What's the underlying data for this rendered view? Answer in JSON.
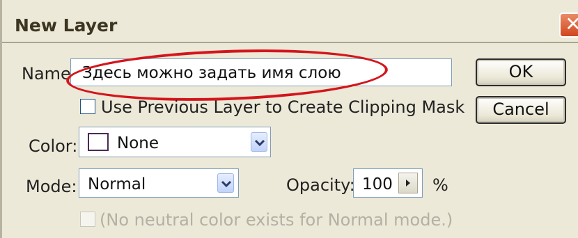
{
  "dialog": {
    "title": "New Layer",
    "close_symbol": "✕",
    "name_label": "Name:",
    "name_value": "Здесь можно задать имя слою",
    "clipping_mask_label": "Use Previous Layer to Create Clipping Mask",
    "clipping_mask_checked": false,
    "color_label": "Color:",
    "color_value": "None",
    "mode_label": "Mode:",
    "mode_value": "Normal",
    "opacity_label": "Opacity:",
    "opacity_value": "100",
    "opacity_unit": "%",
    "neutral_label": "(No neutral color exists for Normal mode.)",
    "ok_label": "OK",
    "cancel_label": "Cancel"
  },
  "icons": {
    "close": "close-icon",
    "dropdown": "chevron-down-icon",
    "spin": "arrow-right-icon"
  },
  "colors": {
    "dialog_bg": "#ece9d8",
    "highlight": "#d4151d",
    "close_button": "#d1451f",
    "field_border": "#7f9db9"
  }
}
